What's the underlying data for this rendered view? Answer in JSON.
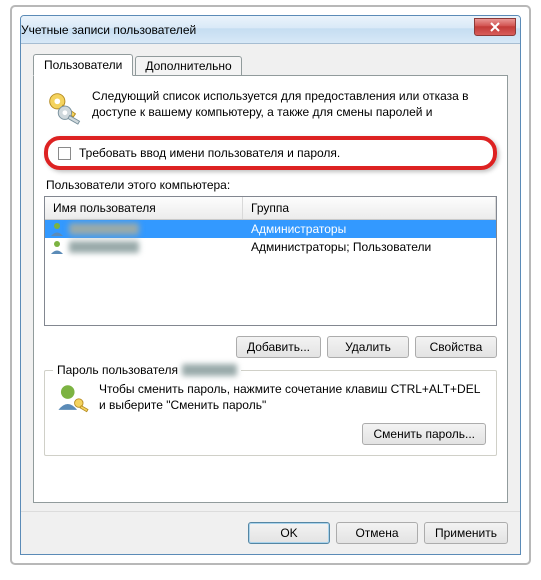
{
  "window": {
    "title": "Учетные записи пользователей"
  },
  "tabs": {
    "users": "Пользователи",
    "advanced": "Дополнительно"
  },
  "intro": "Следующий список используется для предоставления или отказа в доступе к вашему компьютеру, а также для смены паролей и",
  "require_password_label": "Требовать ввод имени пользователя и пароля.",
  "list_label": "Пользователи этого компьютера:",
  "columns": {
    "name": "Имя пользователя",
    "group": "Группа"
  },
  "rows": [
    {
      "group": "Администраторы"
    },
    {
      "group": "Администраторы; Пользователи"
    }
  ],
  "buttons": {
    "add": "Добавить...",
    "remove": "Удалить",
    "properties": "Свойства"
  },
  "password_box": {
    "legend": "Пароль пользователя",
    "text": "Чтобы сменить пароль, нажмите сочетание клавиш CTRL+ALT+DEL и выберите \"Сменить пароль\"",
    "change": "Сменить пароль..."
  },
  "footer": {
    "ok": "OK",
    "cancel": "Отмена",
    "apply": "Применить"
  }
}
